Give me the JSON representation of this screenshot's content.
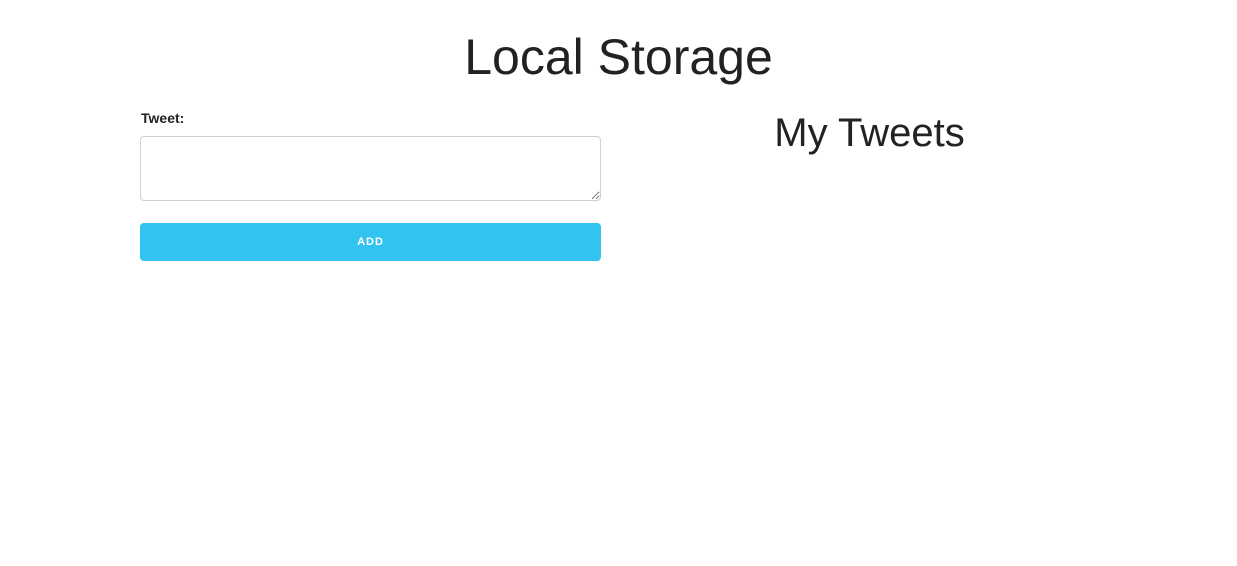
{
  "page": {
    "title": "Local Storage"
  },
  "form": {
    "label": "Tweet:",
    "textarea_value": "",
    "textarea_placeholder": "",
    "button_label": "ADD",
    "button_color": "#33c3f0"
  },
  "tweets": {
    "heading": "My Tweets",
    "items": []
  }
}
